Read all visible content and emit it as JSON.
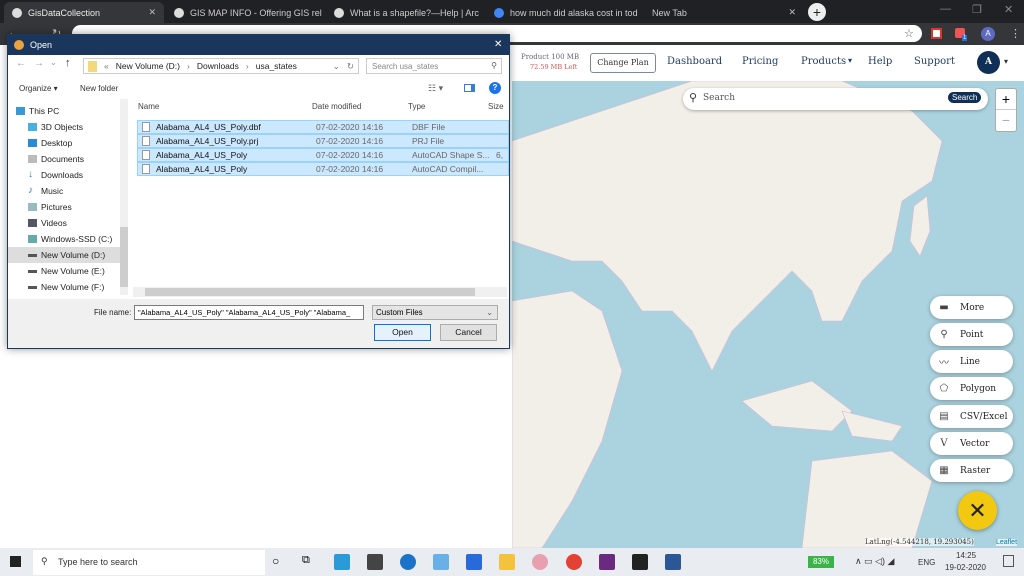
{
  "browser": {
    "tabs": [
      {
        "title": "GisDataCollection",
        "active": true
      },
      {
        "title": "GIS MAP INFO - Offering GIS rel"
      },
      {
        "title": "What is a shapefile?—Help | Arc"
      },
      {
        "title": "how much did alaska cost in tod"
      },
      {
        "title": "New Tab"
      }
    ],
    "new_tab": "+",
    "url": "",
    "profile_initial": "A",
    "extension_badge": "1"
  },
  "site": {
    "plan": "Product 100 MB",
    "left": "72.59 MB Left",
    "change_plan": "Change Plan",
    "nav": [
      "Dashboard",
      "Pricing",
      "Products",
      "Help",
      "Support"
    ],
    "avatar": "A",
    "search_placeholder": "Search",
    "search_button": "Search",
    "zoom_in": "+",
    "zoom_out": "−",
    "tools": [
      {
        "label": "More",
        "icon": "more-icon"
      },
      {
        "label": "Point",
        "icon": "map-pin-icon"
      },
      {
        "label": "Line",
        "icon": "line-icon"
      },
      {
        "label": "Polygon",
        "icon": "polygon-icon"
      },
      {
        "label": "CSV/Excel",
        "icon": "csv-icon"
      },
      {
        "label": "Vector",
        "icon": "vector-icon"
      },
      {
        "label": "Raster",
        "icon": "raster-icon"
      }
    ],
    "latlng": "LatLng(-4.544218, 19.293045)",
    "attribution": "Leaflet",
    "colors": {
      "sea": "#aad3df",
      "land": "#f2efe9",
      "accent": "#f2c811",
      "brand": "#1b365d",
      "plan_left": "#d9534f"
    }
  },
  "dialog": {
    "title": "Open",
    "breadcrumb": [
      "«",
      "New Volume (D:)",
      "›",
      "Downloads",
      "›",
      "usa_states"
    ],
    "search_placeholder": "Search usa_states",
    "organize": "Organize ▾",
    "new_folder": "New folder",
    "nav_items": [
      "This PC",
      "3D Objects",
      "Desktop",
      "Documents",
      "Downloads",
      "Music",
      "Pictures",
      "Videos",
      "Windows-SSD (C:)",
      "New Volume (D:)",
      "New Volume (E:)",
      "New Volume (F:)"
    ],
    "selected_nav": "New Volume (D:)",
    "columns": [
      "Name",
      "Date modified",
      "Type",
      "Size"
    ],
    "files": [
      {
        "name": "Alabama_AL4_US_Poly.dbf",
        "date": "07-02-2020 14:16",
        "type": "DBF File",
        "size": ""
      },
      {
        "name": "Alabama_AL4_US_Poly.prj",
        "date": "07-02-2020 14:16",
        "type": "PRJ File",
        "size": ""
      },
      {
        "name": "Alabama_AL4_US_Poly",
        "date": "07-02-2020 14:16",
        "type": "AutoCAD Shape S...",
        "size": "6,"
      },
      {
        "name": "Alabama_AL4_US_Poly",
        "date": "07-02-2020 14:16",
        "type": "AutoCAD Compil...",
        "size": ""
      }
    ],
    "file_name_label": "File name:",
    "file_name_value": "\"Alabama_AL4_US_Poly\" \"Alabama_AL4_US_Poly\" \"Alabama_",
    "file_type": "Custom Files",
    "open": "Open",
    "cancel": "Cancel"
  },
  "taskbar": {
    "search_placeholder": "Type here to search",
    "battery": "83%",
    "lang": "ENG",
    "time": "14:25",
    "date": "19-02-2020"
  }
}
